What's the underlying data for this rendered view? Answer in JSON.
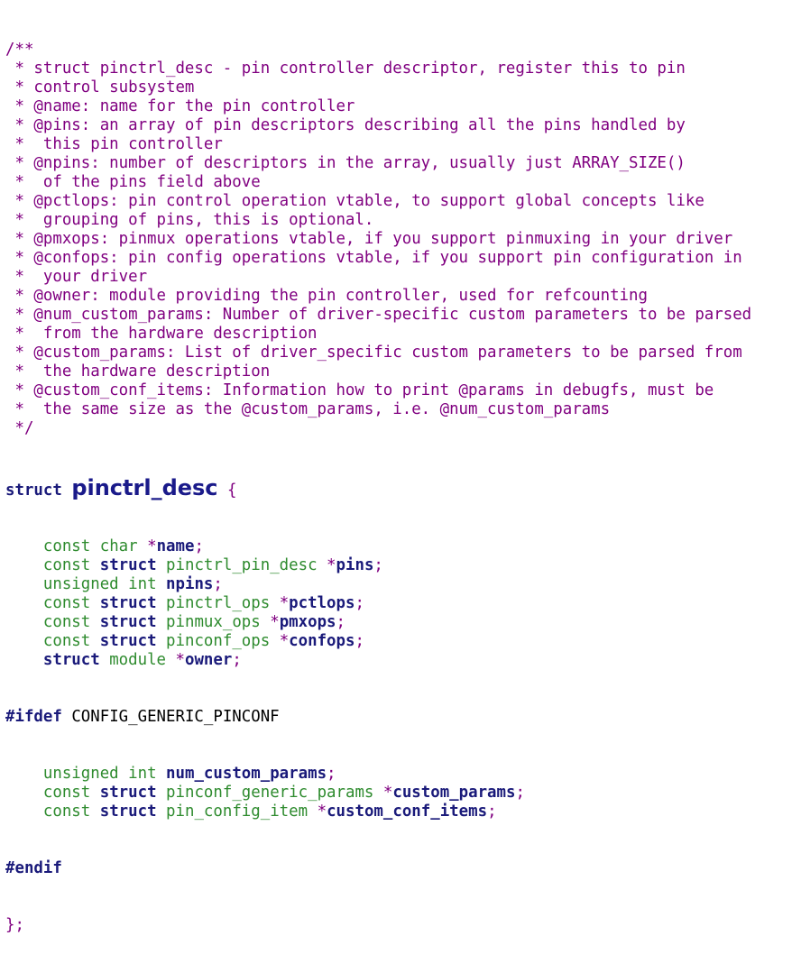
{
  "comment_lines": [
    "/**",
    " * struct pinctrl_desc - pin controller descriptor, register this to pin",
    " * control subsystem",
    " * @name: name for the pin controller",
    " * @pins: an array of pin descriptors describing all the pins handled by",
    " *  this pin controller",
    " * @npins: number of descriptors in the array, usually just ARRAY_SIZE()",
    " *  of the pins field above",
    " * @pctlops: pin control operation vtable, to support global concepts like",
    " *  grouping of pins, this is optional.",
    " * @pmxops: pinmux operations vtable, if you support pinmuxing in your driver",
    " * @confops: pin config operations vtable, if you support pin configuration in",
    " *  your driver",
    " * @owner: module providing the pin controller, used for refcounting",
    " * @num_custom_params: Number of driver-specific custom parameters to be parsed",
    " *  from the hardware description",
    " * @custom_params: List of driver_specific custom parameters to be parsed from",
    " *  the hardware description",
    " * @custom_conf_items: Information how to print @params in debugfs, must be",
    " *  the same size as the @custom_params, i.e. @num_custom_params",
    " */"
  ],
  "decl": {
    "keyword": "struct",
    "name": "pinctrl_desc",
    "open_brace": "{",
    "close": "};"
  },
  "fields_a": [
    {
      "qual": "const",
      "kw": "",
      "type": "char",
      "star": " *",
      "name": "name",
      "end": ";"
    },
    {
      "qual": "const",
      "kw": "struct",
      "type": "pinctrl_pin_desc",
      "star": " *",
      "name": "pins",
      "end": ";"
    },
    {
      "qual": "unsigned",
      "kw": "",
      "type": "int",
      "star": " ",
      "name": "npins",
      "end": ";"
    },
    {
      "qual": "const",
      "kw": "struct",
      "type": "pinctrl_ops",
      "star": " *",
      "name": "pctlops",
      "end": ";"
    },
    {
      "qual": "const",
      "kw": "struct",
      "type": "pinmux_ops",
      "star": " *",
      "name": "pmxops",
      "end": ";"
    },
    {
      "qual": "const",
      "kw": "struct",
      "type": "pinconf_ops",
      "star": " *",
      "name": "confops",
      "end": ";"
    },
    {
      "qual": "",
      "kw": "struct",
      "type": "module",
      "star": " *",
      "name": "owner",
      "end": ";"
    }
  ],
  "ifdef": {
    "directive": "#ifdef",
    "macro": "CONFIG_GENERIC_PINCONF"
  },
  "fields_b": [
    {
      "qual": "unsigned",
      "kw": "",
      "type": "int",
      "star": " ",
      "name": "num_custom_params",
      "end": ";"
    },
    {
      "qual": "const",
      "kw": "struct",
      "type": "pinconf_generic_params",
      "star": " *",
      "name": "custom_params",
      "end": ";"
    },
    {
      "qual": "const",
      "kw": "struct",
      "type": "pin_config_item",
      "star": " *",
      "name": "custom_conf_items",
      "end": ";"
    }
  ],
  "endif": "#endif"
}
